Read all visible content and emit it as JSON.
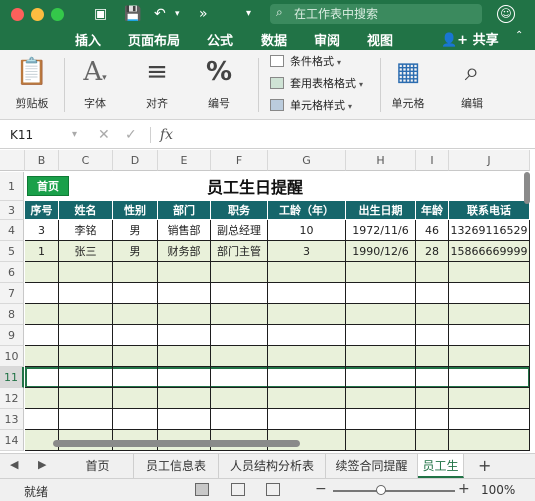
{
  "titlebar": {
    "search_placeholder": "在工作表中搜索",
    "tabs": [
      "插入",
      "页面布局",
      "公式",
      "数据",
      "审阅",
      "视图"
    ],
    "share": "共享"
  },
  "ribbon": {
    "clipboard": "剪贴板",
    "font": "字体",
    "align": "对齐",
    "number": "编号",
    "cond_format": "条件格式",
    "table_format": "套用表格格式",
    "cell_style": "单元格样式",
    "cells": "单元格",
    "edit": "编辑"
  },
  "formula_bar": {
    "name_box": "K11",
    "fx": "fx",
    "content": ""
  },
  "grid": {
    "columns": [
      "B",
      "C",
      "D",
      "E",
      "F",
      "G",
      "H",
      "I",
      "J"
    ],
    "rows": [
      "1",
      "3",
      "4",
      "5",
      "6",
      "7",
      "8",
      "9",
      "10",
      "11",
      "12",
      "13",
      "14"
    ],
    "selected_row": "11"
  },
  "sheet": {
    "home_button": "首页",
    "title": "员工生日提醒",
    "headers": [
      "序号",
      "姓名",
      "性别",
      "部门",
      "职务",
      "工龄（年）",
      "出生日期",
      "年龄",
      "联系电话"
    ],
    "records": [
      [
        "3",
        "李铭",
        "男",
        "销售部",
        "副总经理",
        "10",
        "1972/11/6",
        "46",
        "13269116529"
      ],
      [
        "1",
        "张三",
        "男",
        "财务部",
        "部门主管",
        "3",
        "1990/12/6",
        "28",
        "15866669999"
      ]
    ]
  },
  "tabs": {
    "sheets": [
      "首页",
      "员工信息表",
      "人员结构分析表",
      "续签合同提醒",
      "员工生"
    ],
    "active_index": 4
  },
  "status": {
    "text": "就绪",
    "zoom": "100%"
  },
  "colors": {
    "accent": "#217346",
    "header_fill": "#16666b",
    "band_fill": "#e9f1da",
    "home_button": "#1aa04a"
  }
}
